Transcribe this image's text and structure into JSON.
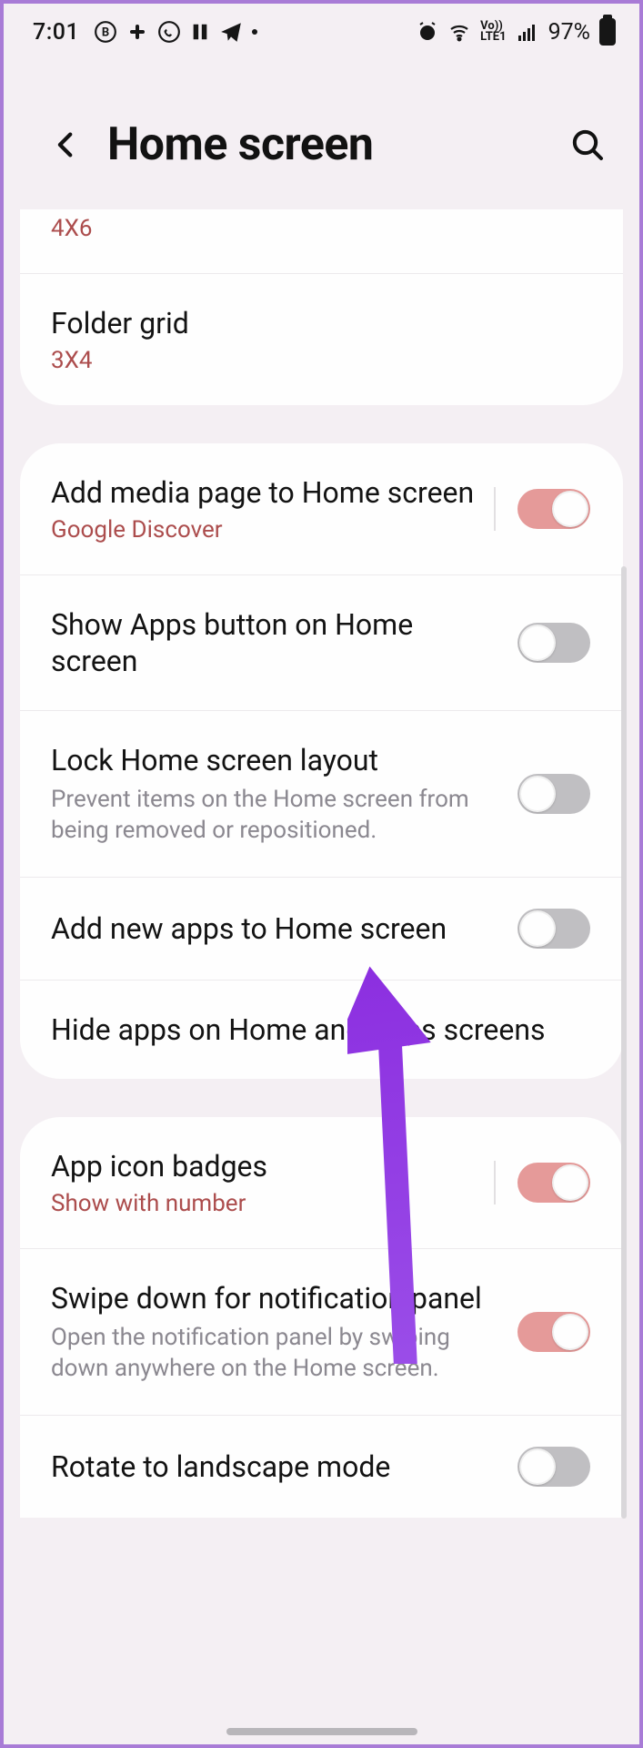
{
  "status": {
    "time": "7:01",
    "battery_pct": "97%"
  },
  "header": {
    "title": "Home screen"
  },
  "card1": {
    "partial_value": "4X6",
    "folder_grid_label": "Folder grid",
    "folder_grid_value": "3X4"
  },
  "card2": {
    "media_page_label": "Add media page to Home screen",
    "media_page_sub": "Google Discover",
    "media_page_on": true,
    "apps_button_label": "Show Apps button on Home screen",
    "apps_button_on": false,
    "lock_layout_label": "Lock Home screen layout",
    "lock_layout_sub": "Prevent items on the Home screen from being removed or repositioned.",
    "lock_layout_on": false,
    "add_new_apps_label": "Add new apps to Home screen",
    "add_new_apps_on": false,
    "hide_apps_label": "Hide apps on Home and Apps screens"
  },
  "card3": {
    "badges_label": "App icon badges",
    "badges_sub": "Show with number",
    "badges_on": true,
    "swipe_label": "Swipe down for notification panel",
    "swipe_sub": "Open the notification panel by swiping down anywhere on the Home screen.",
    "swipe_on": true,
    "rotate_label": "Rotate to landscape mode",
    "rotate_on": false
  }
}
